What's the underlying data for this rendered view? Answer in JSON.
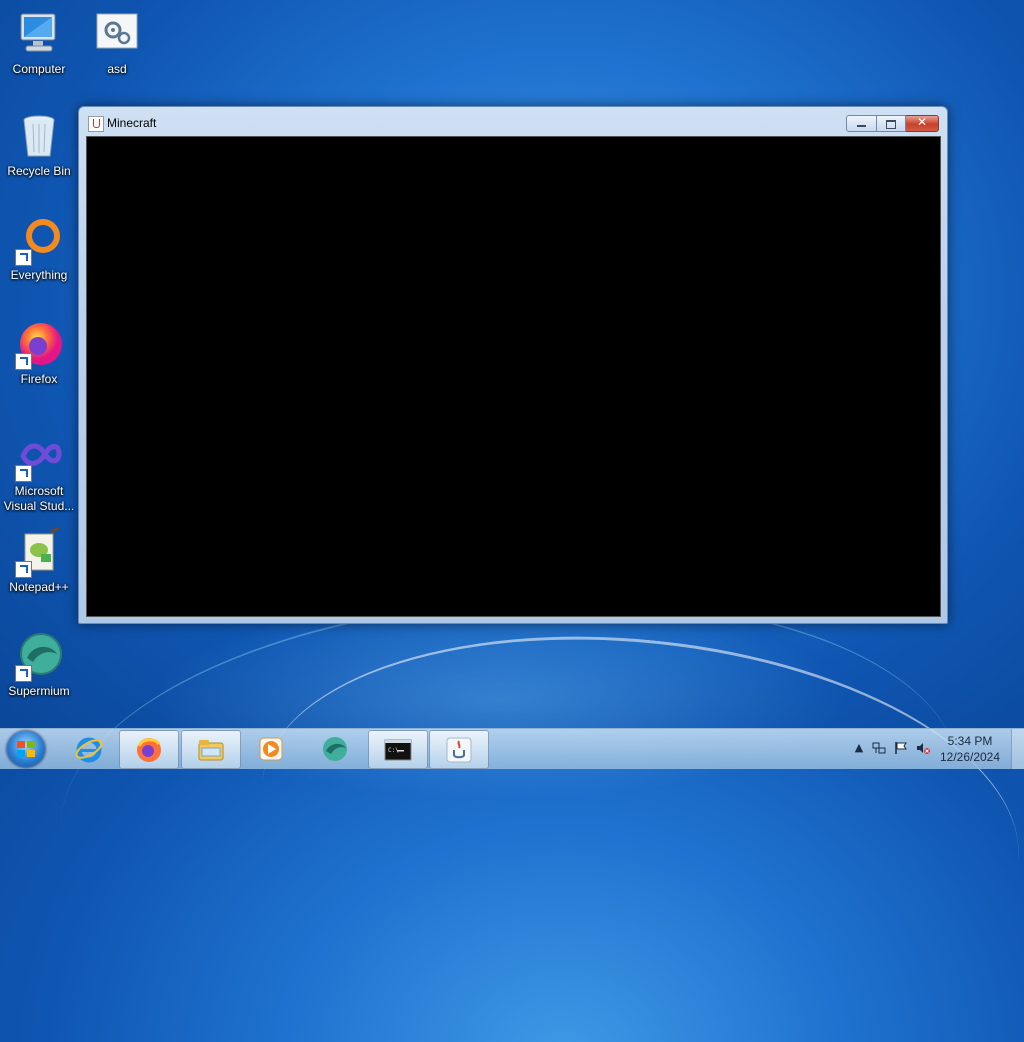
{
  "desktop": {
    "icons": [
      {
        "label": "Computer"
      },
      {
        "label": "asd"
      },
      {
        "label": "Recycle Bin"
      },
      {
        "label": "Everything"
      },
      {
        "label": "Firefox"
      },
      {
        "label": "Microsoft Visual Stud..."
      },
      {
        "label": "Notepad++"
      },
      {
        "label": "Supermium"
      }
    ]
  },
  "window": {
    "title": "Minecraft",
    "close_symbol": "✕"
  },
  "taskbar": {
    "items": [
      {
        "name": "Internet Explorer",
        "icon": "ie-icon"
      },
      {
        "name": "Firefox",
        "icon": "firefox-icon"
      },
      {
        "name": "Windows Explorer",
        "icon": "folder-icon"
      },
      {
        "name": "Windows Media Player",
        "icon": "media-player-icon"
      },
      {
        "name": "Supermium",
        "icon": "supermium-icon"
      },
      {
        "name": "Command Prompt",
        "icon": "cmd-icon"
      },
      {
        "name": "Java",
        "icon": "java-icon"
      }
    ],
    "clock": {
      "time": "5:34 PM",
      "date": "12/26/2024"
    }
  },
  "colors": {
    "window_client": "#000000",
    "close_button": "#c7412b",
    "desktop_blue": "#1f72cf"
  }
}
